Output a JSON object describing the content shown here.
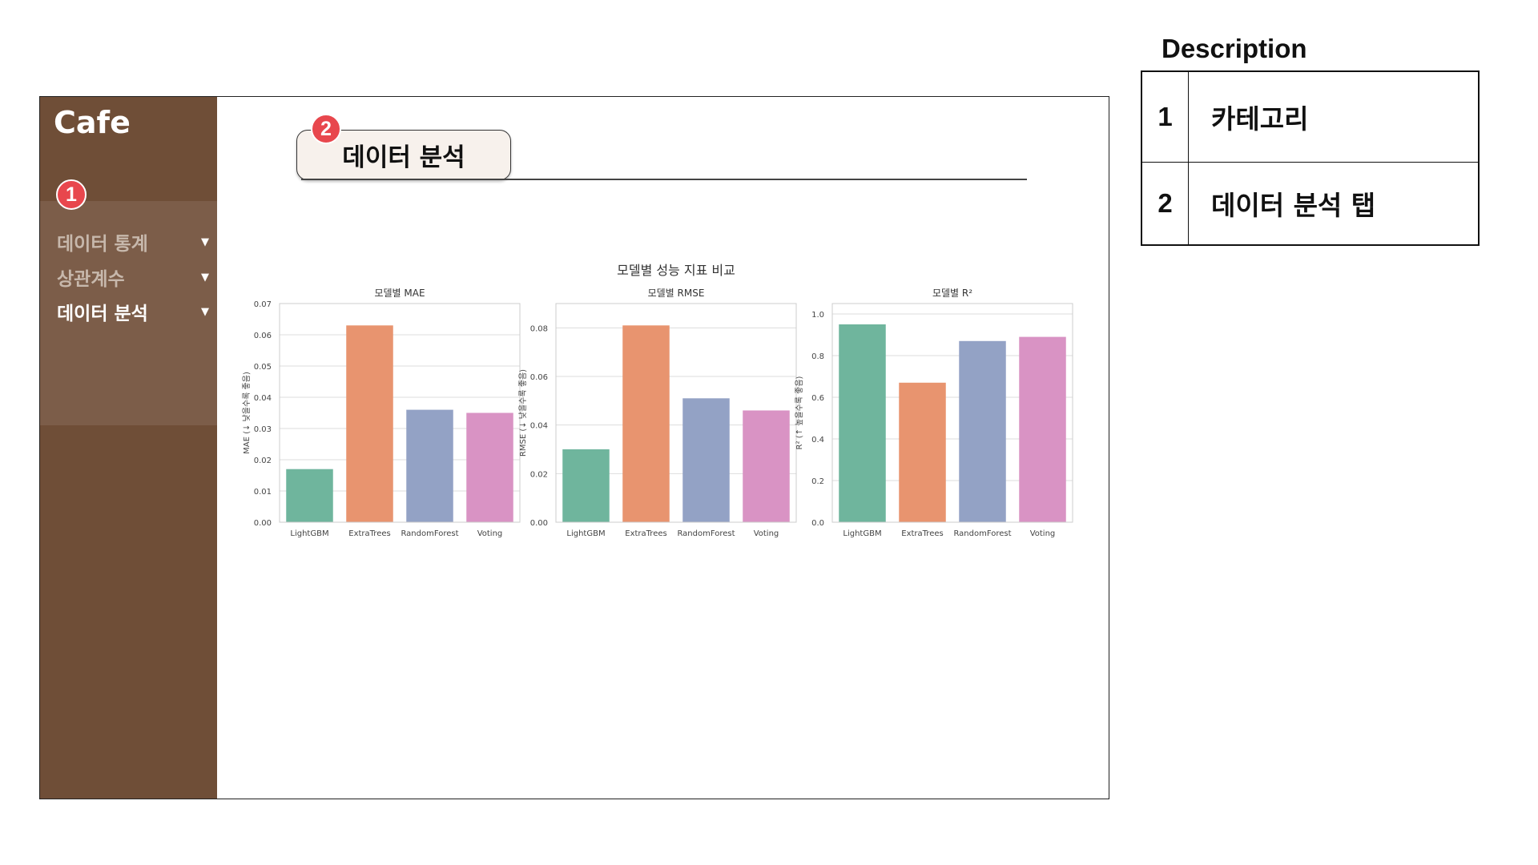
{
  "app": {
    "brand": "Cafe"
  },
  "sidebar": {
    "items": [
      {
        "label": "데이터 통계",
        "caret": "▼",
        "active": false
      },
      {
        "label": "상관계수",
        "caret": "▼",
        "active": false
      },
      {
        "label": "데이터 분석",
        "caret": "▼",
        "active": true
      }
    ]
  },
  "badges": {
    "one": "1",
    "two": "2"
  },
  "tab": {
    "label": "데이터 분석"
  },
  "chart_data": {
    "type": "bar",
    "title": "모델별 성능 지표 비교",
    "categories": [
      "LightGBM",
      "ExtraTrees",
      "RandomForest",
      "Voting"
    ],
    "colors": [
      "#6fb59d",
      "#e8946f",
      "#93a2c5",
      "#d993c4"
    ],
    "grid": true,
    "subplots": [
      {
        "title": "모델별 MAE",
        "ylabel": "MAE (↓ 낮을수록 좋음)",
        "ylim": [
          0,
          0.07
        ],
        "ticks": [
          "0.00",
          "0.01",
          "0.02",
          "0.03",
          "0.04",
          "0.05",
          "0.06",
          "0.07"
        ],
        "tick_values": [
          0,
          0.01,
          0.02,
          0.03,
          0.04,
          0.05,
          0.06,
          0.07
        ],
        "values": [
          0.017,
          0.063,
          0.036,
          0.035
        ]
      },
      {
        "title": "모델별 RMSE",
        "ylabel": "RMSE (↓ 낮을수록 좋음)",
        "ylim": [
          0,
          0.09
        ],
        "ticks": [
          "0.00",
          "0.02",
          "0.04",
          "0.06",
          "0.08"
        ],
        "tick_values": [
          0,
          0.02,
          0.04,
          0.06,
          0.08
        ],
        "values": [
          0.03,
          0.081,
          0.051,
          0.046
        ]
      },
      {
        "title": "모델별 R²",
        "ylabel": "R² (↑ 높을수록 좋음)",
        "ylim": [
          0,
          1.05
        ],
        "ticks": [
          "0.0",
          "0.2",
          "0.4",
          "0.6",
          "0.8",
          "1.0"
        ],
        "tick_values": [
          0,
          0.2,
          0.4,
          0.6,
          0.8,
          1.0
        ],
        "values": [
          0.95,
          0.67,
          0.87,
          0.89
        ]
      }
    ]
  },
  "description": {
    "title": "Description",
    "rows": [
      {
        "num": "1",
        "text": "카테고리"
      },
      {
        "num": "2",
        "text": "데이터 분석 탭"
      }
    ]
  }
}
